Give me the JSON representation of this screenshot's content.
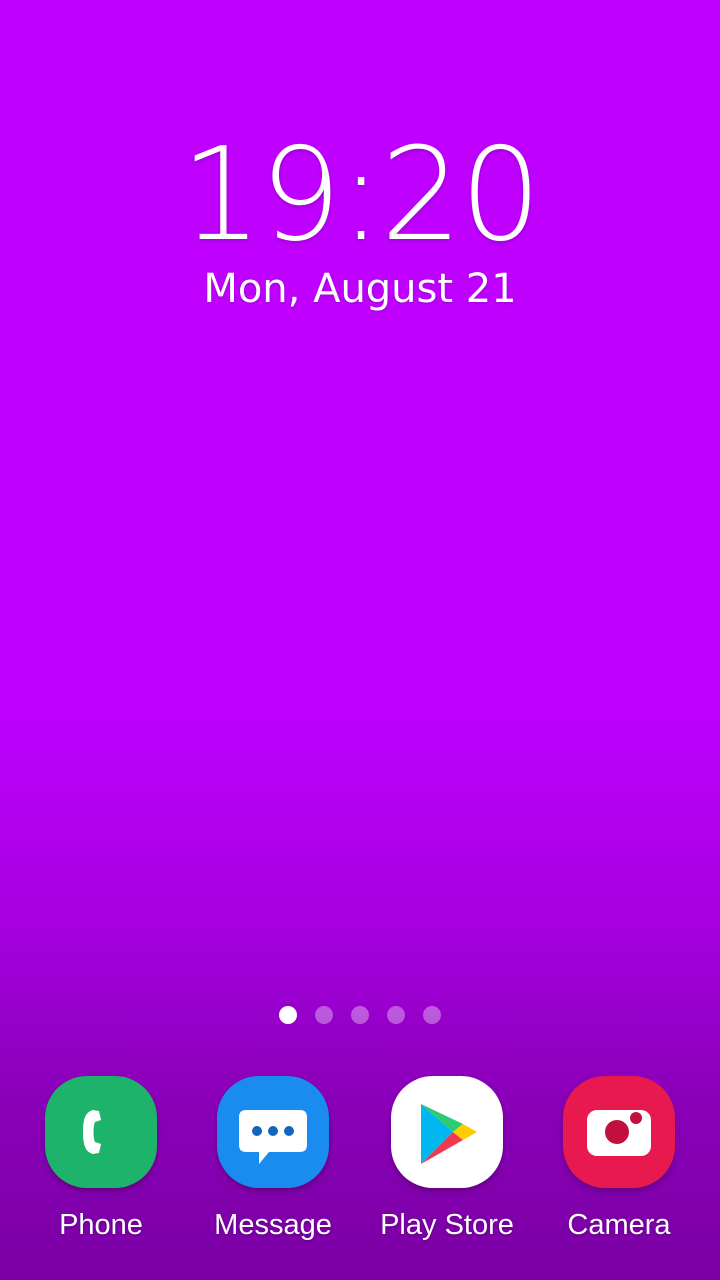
{
  "lockscreen": {
    "time": "19:20",
    "date": "Mon, August 21"
  },
  "pages": {
    "count": 5,
    "active": 1
  },
  "dock": {
    "apps": [
      {
        "label": "Phone",
        "icon": "phone-icon",
        "color": "#1db36a"
      },
      {
        "label": "Message",
        "icon": "message-icon",
        "color": "#1a8cf0"
      },
      {
        "label": "Play Store",
        "icon": "play-store-icon",
        "color": "#ffffff"
      },
      {
        "label": "Camera",
        "icon": "camera-icon",
        "color": "#e8194f"
      }
    ]
  }
}
